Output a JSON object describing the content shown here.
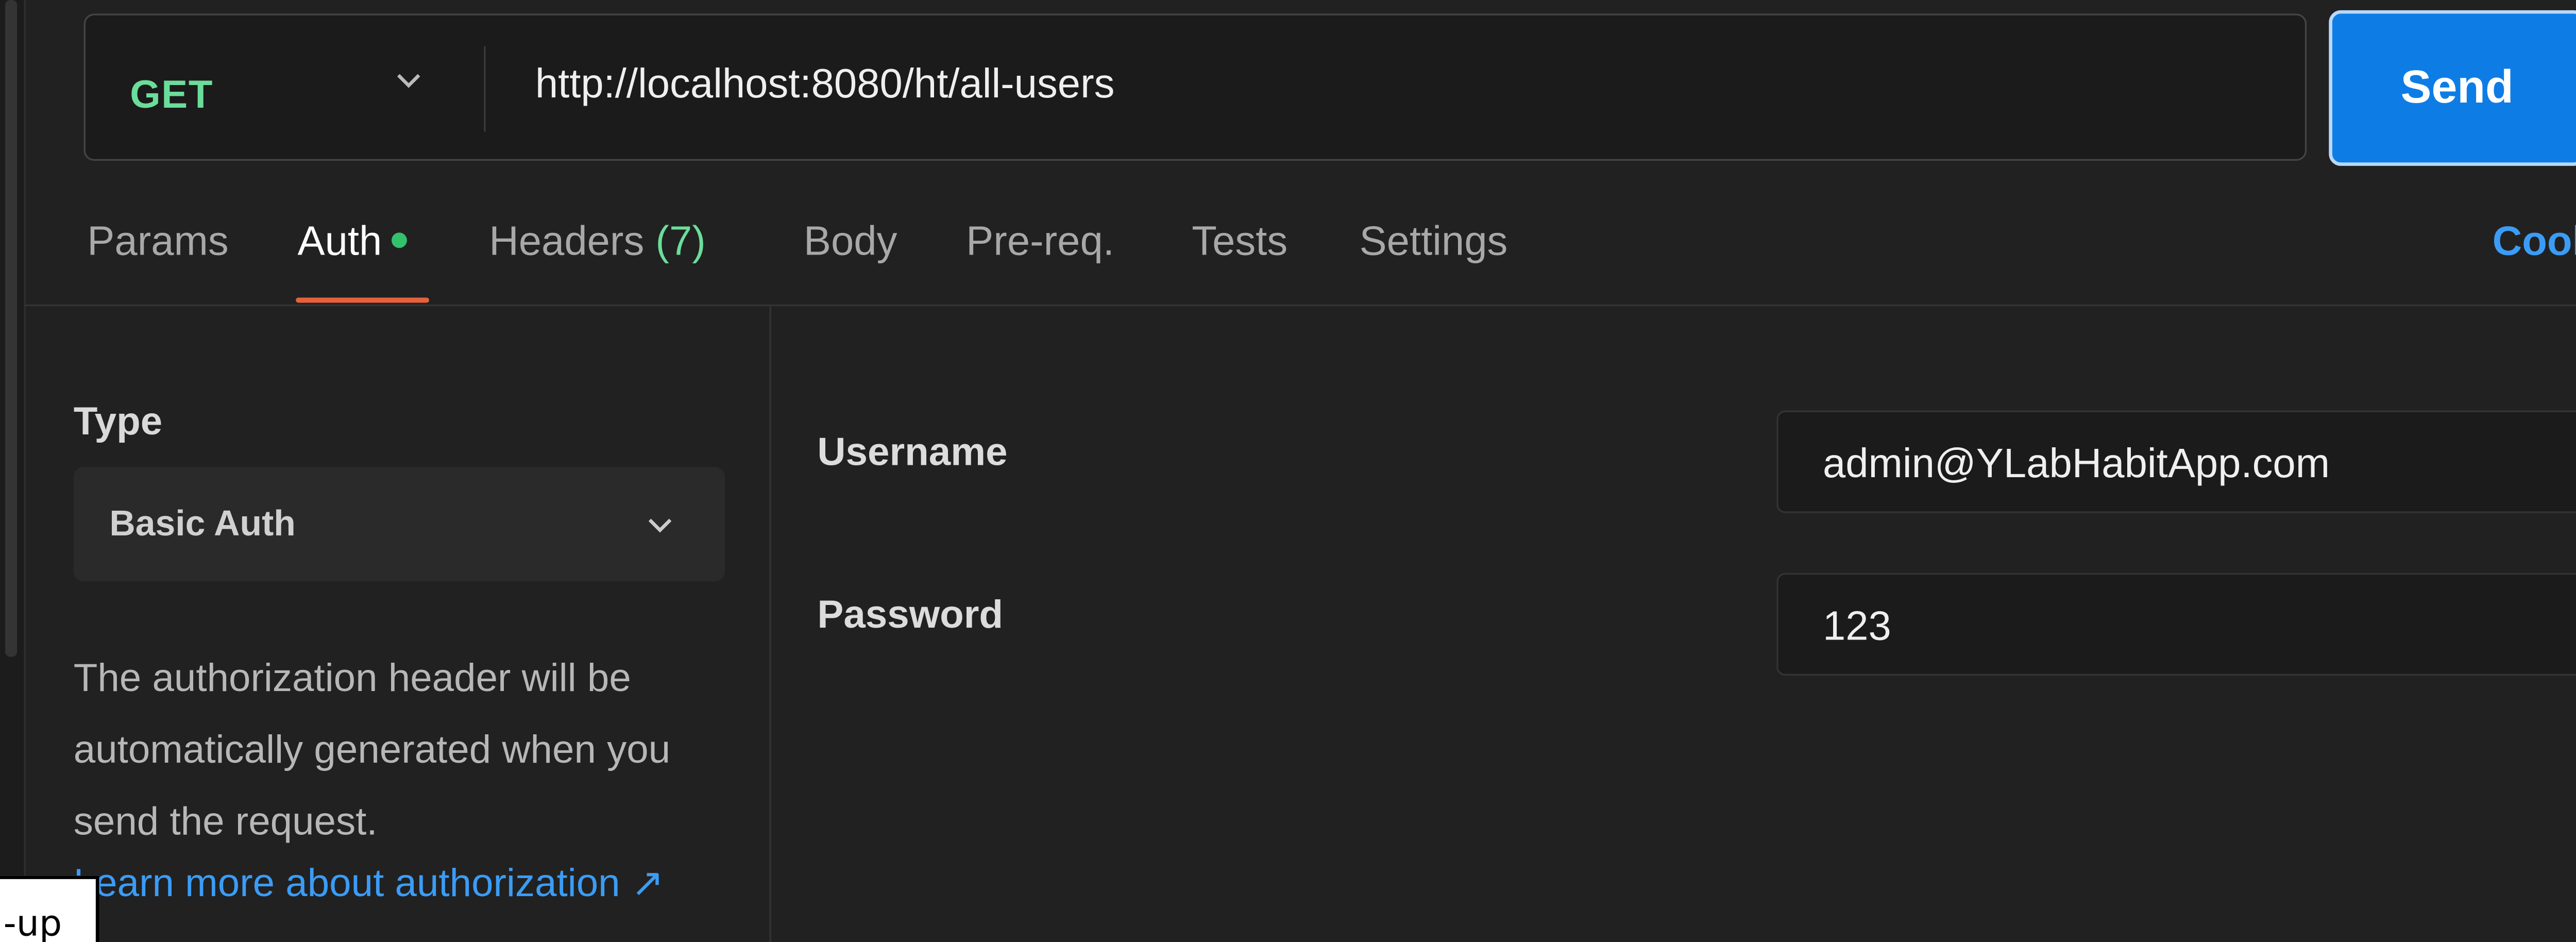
{
  "request": {
    "method": "GET",
    "url": "http://localhost:8080/ht/all-users",
    "send_label": "Send"
  },
  "tabs": [
    {
      "label": "Params"
    },
    {
      "label": "Auth"
    },
    {
      "label": "Headers",
      "count": "(7)"
    },
    {
      "label": "Body"
    },
    {
      "label": "Pre-req."
    },
    {
      "label": "Tests"
    },
    {
      "label": "Settings"
    }
  ],
  "cookies_label": "Cookies",
  "auth": {
    "type_label": "Type",
    "type_value": "Basic Auth",
    "help_text": "The authorization header will be automatically generated when you send the request.",
    "learn_more": "Learn more about authorization ↗",
    "username_label": "Username",
    "username_value": "admin@YLabHabitApp.com",
    "password_label": "Password",
    "password_value": "123"
  },
  "popup_text": "-up",
  "colors": {
    "accent": "#0d7de5",
    "method": "#6bdd9a",
    "active_tab_underline": "#e8613c",
    "link": "#3b9cf5",
    "warning": "#e8c23a"
  }
}
